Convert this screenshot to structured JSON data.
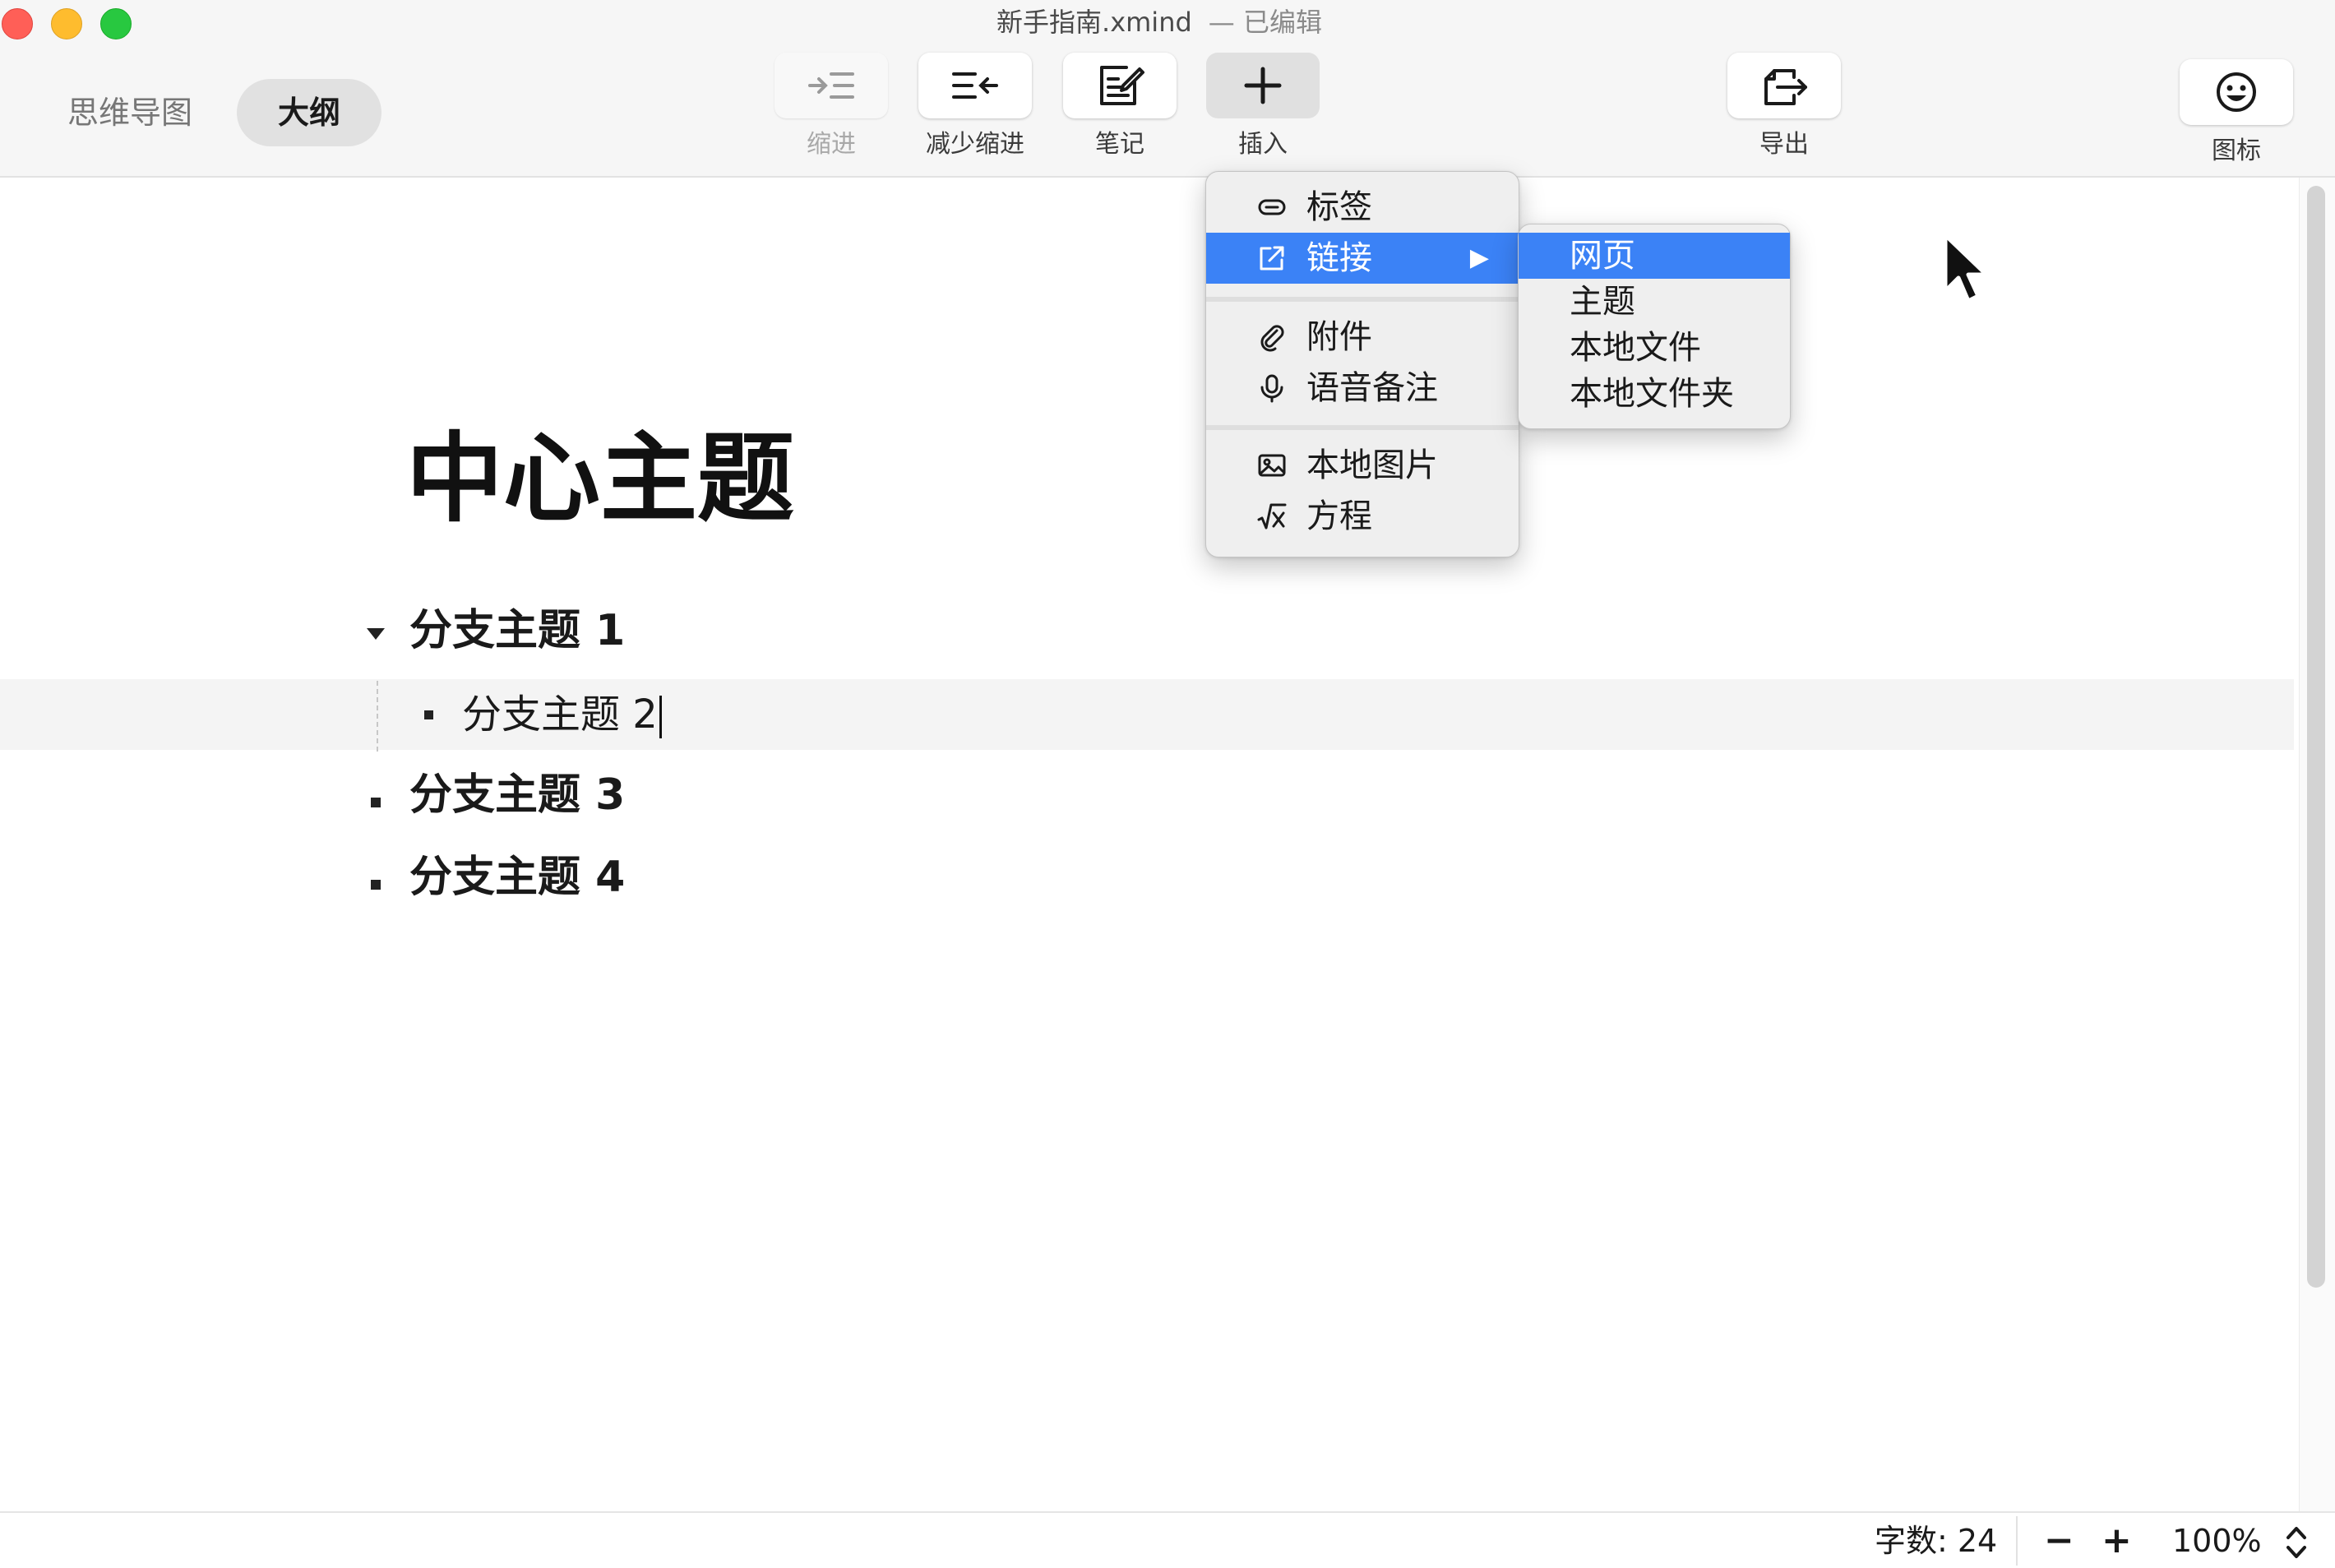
{
  "window": {
    "filename": "新手指南.xmind",
    "status": "— 已编辑"
  },
  "view_switch": {
    "mindmap": "思维导图",
    "outline": "大纲",
    "active": "outline"
  },
  "toolbar": {
    "indent": "缩进",
    "outdent": "减少缩进",
    "notes": "笔记",
    "insert": "插入",
    "export": "导出",
    "icons": "图标"
  },
  "insert_menu": {
    "items": [
      {
        "label": "标签",
        "icon": "tag-icon"
      },
      {
        "label": "链接",
        "icon": "external-link-icon",
        "has_submenu": true,
        "selected": true
      },
      {
        "label": "附件",
        "icon": "paperclip-icon"
      },
      {
        "label": "语音备注",
        "icon": "microphone-icon"
      },
      {
        "label": "本地图片",
        "icon": "image-icon"
      },
      {
        "label": "方程",
        "icon": "equation-icon"
      }
    ],
    "submenu_arrow": "▶"
  },
  "link_submenu": {
    "items": [
      {
        "label": "网页",
        "selected": true
      },
      {
        "label": "主题"
      },
      {
        "label": "本地文件"
      },
      {
        "label": "本地文件夹"
      }
    ]
  },
  "outline": {
    "central_topic": "中心主题",
    "branches": [
      {
        "label": "分支主题 1",
        "expanded": true,
        "children": [
          {
            "label": "分支主题 2",
            "editing": true
          }
        ]
      },
      {
        "label": "分支主题 3"
      },
      {
        "label": "分支主题 4"
      }
    ]
  },
  "status_bar": {
    "word_count": "字数: 24",
    "zoom_out": "−",
    "zoom_in": "+",
    "zoom": "100%"
  },
  "colors": {
    "selection": "#3b82f6",
    "traffic_close": "#ff5f57",
    "traffic_minimize": "#febc2e",
    "traffic_maximize": "#28c840"
  }
}
